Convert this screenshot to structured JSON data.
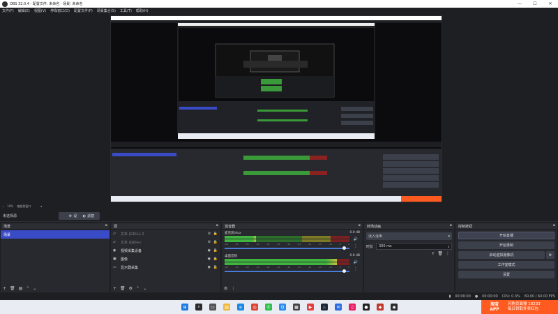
{
  "window": {
    "title": "OBS 32.0.4 - 配置文件: 未命名 - 场景: 未命名",
    "min": "—",
    "max": "☐",
    "close": "✕"
  },
  "menu": [
    "文件(F)",
    "编辑(E)",
    "视图(V)",
    "停靠窗口(D)",
    "配置文件(P)",
    "场景集合(S)",
    "工具(T)",
    "帮助(H)"
  ],
  "zoom": {
    "value": "19%",
    "label": "缩放到窗口"
  },
  "source_toolbar": {
    "no_source": "未选择源",
    "properties": "设置",
    "filters": "滤镜"
  },
  "scenes": {
    "title": "场景",
    "items": [
      "场景"
    ]
  },
  "sources": {
    "title": "源",
    "items": [
      {
        "name": "文本 (GDI+) 2",
        "icon": "text-icon",
        "muted": true
      },
      {
        "name": "文本 (GDI+)",
        "icon": "text-icon",
        "muted": true
      },
      {
        "name": "视频采集设备",
        "icon": "camera-icon",
        "muted": false
      },
      {
        "name": "图像",
        "icon": "image-icon",
        "muted": false
      },
      {
        "name": "显示器采集",
        "icon": "monitor-icon",
        "muted": false
      }
    ]
  },
  "mixer": {
    "title": "混音器",
    "channels": [
      {
        "name": "麦克风/Aux",
        "db": "0.0 dB",
        "level": 0.25,
        "volume": 0.97
      },
      {
        "name": "桌面音频",
        "db": "0.0 dB",
        "level": 0.9,
        "volume": 0.97
      }
    ],
    "ticks": [
      "-60",
      "-55",
      "-50",
      "-45",
      "-40",
      "-35",
      "-30",
      "-25",
      "-20",
      "-15",
      "-10",
      "-5",
      "0"
    ]
  },
  "transitions": {
    "title": "转场动画",
    "selected": "淡入淡出",
    "duration_label": "时长",
    "duration": "300 ms"
  },
  "controls": {
    "title": "控制按钮",
    "buttons": [
      "开始直播",
      "开始录制",
      "启动虚拟摄像机",
      "工作室模式",
      "设置"
    ]
  },
  "status": {
    "time1": "00:00:00",
    "time2": "00:00:00",
    "cpu": "CPU: 0.3%",
    "fps": "60.00 / 60.00 FPS"
  },
  "taskbar": {
    "icons": [
      "windows-icon",
      "search-icon",
      "task-view-icon",
      "explorer-icon",
      "edge-icon",
      "chrome-icon",
      "wechat-icon",
      "qq-icon",
      "store-icon",
      "video-icon",
      "steam-icon",
      "mail-icon",
      "music-icon",
      "record-icon",
      "app-icon",
      "obs-icon"
    ]
  },
  "ad": {
    "brand": "淘宝",
    "brand2": "APP",
    "line1": "闪购页面搜 18233",
    "line2": "每日领取外卖红包"
  },
  "colors": {
    "accent": "#3a4bc7",
    "select": "#3a4bc7"
  }
}
